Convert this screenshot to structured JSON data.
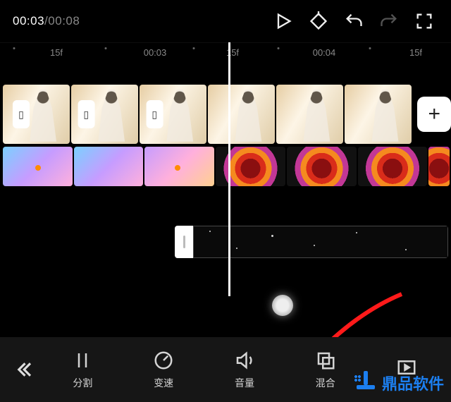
{
  "time": {
    "current": "00:03",
    "separator": "/",
    "duration": "00:08"
  },
  "ruler": {
    "ticks": [
      {
        "label": "15f",
        "pos": 80
      },
      {
        "label": "00:03",
        "pos": 220
      },
      {
        "label": "15f",
        "pos": 330
      },
      {
        "label": "00:04",
        "pos": 460
      },
      {
        "label": "15f",
        "pos": 590
      }
    ],
    "dot1": 20
  },
  "add_label": "+",
  "tools": {
    "split": "分割",
    "speed": "变速",
    "volume": "音量",
    "blend": "混合",
    "pip": ""
  },
  "watermark": "鼎品软件"
}
